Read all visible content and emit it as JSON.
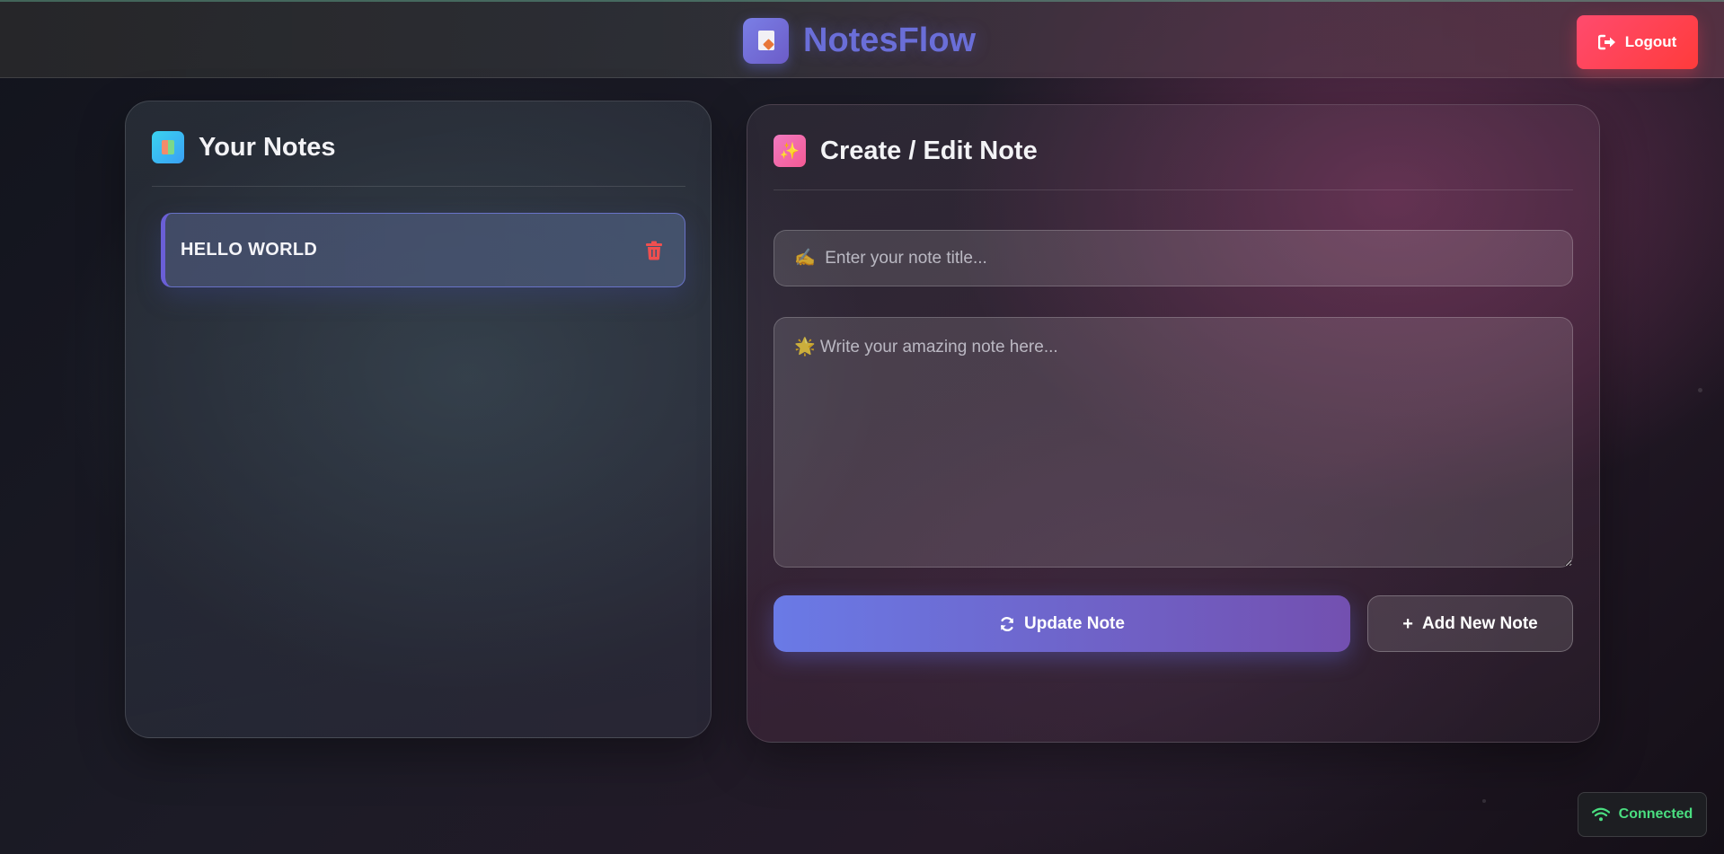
{
  "app": {
    "name": "NotesFlow",
    "logo_icon": "document-pen-icon"
  },
  "header": {
    "logout_label": "Logout",
    "logout_icon": "sign-out-icon"
  },
  "notes_panel": {
    "title": "Your Notes",
    "icon": "books-icon",
    "notes": [
      {
        "title": "HELLO WORLD",
        "delete_icon": "trash-icon"
      }
    ]
  },
  "editor_panel": {
    "title": "Create / Edit Note",
    "icon": "sparkles-icon",
    "title_field": {
      "icon": "✍",
      "placeholder": "Enter your note title...",
      "value": ""
    },
    "content_field": {
      "icon": "🌟",
      "placeholder": "Write your amazing note here...",
      "value": ""
    },
    "update_label": "Update Note",
    "update_icon": "sync-icon",
    "add_label": "Add New Note",
    "add_icon": "plus-icon"
  },
  "status": {
    "label": "Connected",
    "icon": "wifi-icon",
    "color": "#4ade80"
  },
  "colors": {
    "accent": "#6a6ed8",
    "logout": "#ff4b6e",
    "update_button": "#6a7ae6"
  }
}
